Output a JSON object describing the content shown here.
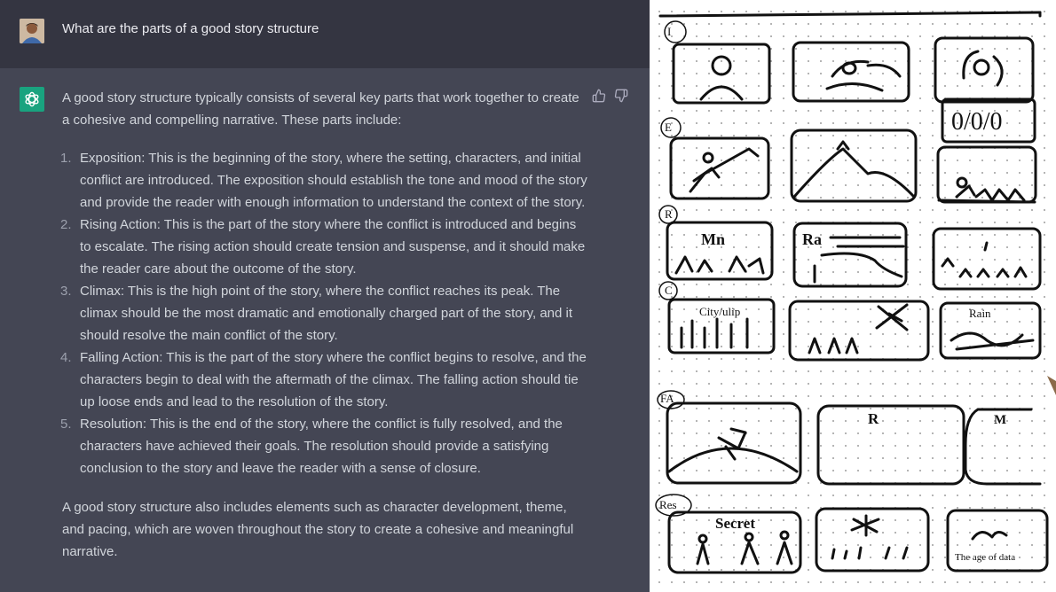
{
  "user_message": {
    "text": "What are the parts of a good story structure"
  },
  "assistant_message": {
    "intro": "A good story structure typically consists of several key parts that work together to create a cohesive and compelling narrative. These parts include:",
    "list": [
      {
        "number": "1.",
        "text": "Exposition: This is the beginning of the story, where the setting, characters, and initial conflict are introduced. The exposition should establish the tone and mood of the story and provide the reader with enough information to understand the context of the story."
      },
      {
        "number": "2.",
        "text": "Rising Action: This is the part of the story where the conflict is introduced and begins to escalate. The rising action should create tension and suspense, and it should make the reader care about the outcome of the story."
      },
      {
        "number": "3.",
        "text": "Climax: This is the high point of the story, where the conflict reaches its peak. The climax should be the most dramatic and emotionally charged part of the story, and it should resolve the main conflict of the story."
      },
      {
        "number": "4.",
        "text": "Falling Action: This is the part of the story where the conflict begins to resolve, and the characters begin to deal with the aftermath of the climax. The falling action should tie up loose ends and lead to the resolution of the story."
      },
      {
        "number": "5.",
        "text": "Resolution: This is the end of the story, where the conflict is fully resolved, and the characters have achieved their goals. The resolution should provide a satisfying conclusion to the story and leave the reader with a sense of closure."
      }
    ],
    "outro": "A good story structure also includes elements such as character development, theme, and pacing, which are woven throughout the story to create a cohesive and meaningful narrative."
  },
  "icons": {
    "user_avatar": "user-avatar",
    "assistant": "openai-logo-icon",
    "thumbs_up": "thumbs-up-icon",
    "thumbs_down": "thumbs-down-icon"
  },
  "sketch": {
    "row_labels": [
      "I",
      "E",
      "R",
      "C",
      "FA",
      "Res"
    ],
    "panel_text": {
      "counter": "0/0/0",
      "rising_1": "Mn",
      "rising_2": "Ra",
      "climax_1": "City/ulip",
      "climax_3": "Rain",
      "falling_2": "R",
      "falling_3": "M",
      "res_1": "Secret",
      "res_3": "The age of data"
    }
  },
  "colors": {
    "user_bg": "#343541",
    "assistant_bg": "#444654",
    "text": "#d1d5db",
    "brand": "#19a37f"
  }
}
